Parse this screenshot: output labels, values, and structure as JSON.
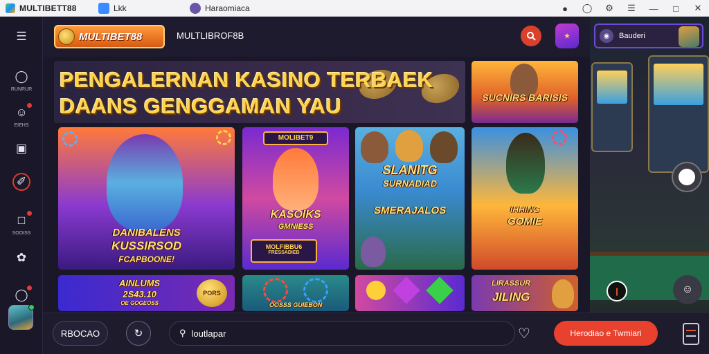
{
  "titlebar": {
    "app_name": "MULTIBETT88",
    "tab1_label": "Lkk",
    "tab2_label": "Haraomiaca",
    "icons": [
      "coin-icon",
      "chrome-icon",
      "settings-icon",
      "menu-icon",
      "minimize-icon",
      "maximize-icon",
      "close-icon"
    ]
  },
  "rail": {
    "items": [
      {
        "label": "",
        "icon": "hamburger-icon"
      },
      {
        "label": "RUNRUR",
        "icon": "chat-icon"
      },
      {
        "label": "EIEHS",
        "icon": "gift-icon"
      },
      {
        "label": "",
        "icon": "image-icon"
      },
      {
        "label": "",
        "icon": "pen-icon"
      },
      {
        "label": "SOOISS",
        "icon": "message-icon"
      },
      {
        "label": "",
        "icon": "puzzle-icon"
      },
      {
        "label": "",
        "icon": "tag-icon"
      }
    ]
  },
  "header": {
    "logo_text": "MULTIBET88",
    "site_name": "MULTLIBROF8B"
  },
  "hero": {
    "line1": "PENGALERNAN KASINO TERBAEK",
    "line2": "DAANS GENGGAMAN YAU"
  },
  "cards": {
    "top_right": "SUCNIRS BARISIS",
    "big_left": {
      "line1": "DANIBALENS",
      "line2": "KUSSIRSOD",
      "line3": "FCAPBOONE!"
    },
    "col2": {
      "badge": "MOLIBET9",
      "title1": "KASOIKS",
      "title2": "GMNIESS",
      "bottom1": "MOLFIBBU6",
      "bottom2": "FRESSADIEB"
    },
    "col3": {
      "title1": "SLANITG",
      "title2": "SURNADIAD",
      "title3": "SMERAJALOS"
    },
    "col4": {
      "title1": "IHHING",
      "title2": "GOMIE"
    },
    "row2_1": {
      "line1": "AINLUMS",
      "line2": "2S43.10",
      "line3": "OE GOGEOSS",
      "coin": "PORS"
    },
    "row2_2": {
      "line1": "OOSSS GUIEBON"
    },
    "row2_4": {
      "line1": "LIRASSUR",
      "line2": "JILING"
    }
  },
  "rpane": {
    "user_name": "Bauderi",
    "chat_icon": "chat-bubble-icon"
  },
  "bottombar": {
    "account_label": "RBOCAO",
    "input_text": "loutlapar",
    "cta_label": "Herodiao e Twmiari"
  },
  "colors": {
    "accent": "#e8412e",
    "gold": "#ffd34d",
    "bg": "#1a1729"
  }
}
